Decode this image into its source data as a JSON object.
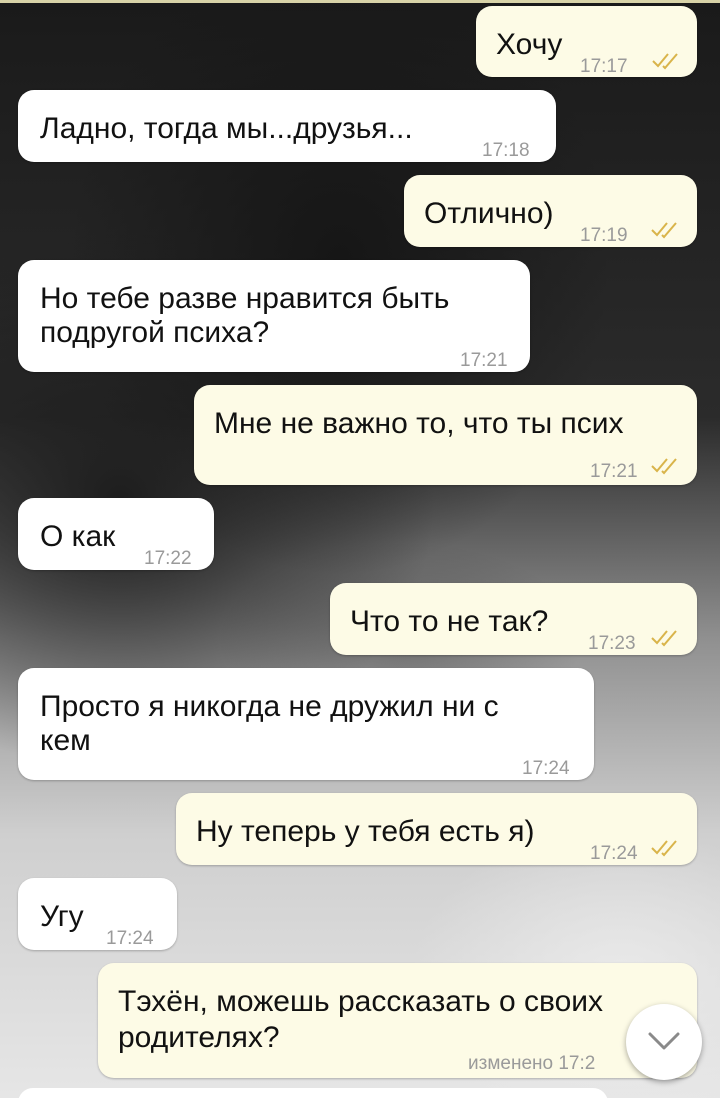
{
  "chat": {
    "messages": [
      {
        "id": "m1",
        "side": "out",
        "text": "Хочу",
        "time": "17:17",
        "read": true
      },
      {
        "id": "m2",
        "side": "in",
        "text": "Ладно, тогда мы...друзья...",
        "time": "17:18"
      },
      {
        "id": "m3",
        "side": "out",
        "text": "Отлично)",
        "time": "17:19",
        "read": true
      },
      {
        "id": "m4",
        "side": "in",
        "text_lines": [
          "Но тебе разве нравится быть",
          "подругой психа?"
        ],
        "time": "17:21"
      },
      {
        "id": "m5",
        "side": "out",
        "text": "Мне не важно то, что ты псих",
        "time": "17:21",
        "read": true
      },
      {
        "id": "m6",
        "side": "in",
        "text": "О как",
        "time": "17:22"
      },
      {
        "id": "m7",
        "side": "out",
        "text": "Что то не так?",
        "time": "17:23",
        "read": true
      },
      {
        "id": "m8",
        "side": "in",
        "text_lines": [
          "Просто я никогда не дружил ни с",
          "кем"
        ],
        "time": "17:24"
      },
      {
        "id": "m9",
        "side": "out",
        "text": "Ну теперь у тебя есть я)",
        "time": "17:24",
        "read": true
      },
      {
        "id": "m10",
        "side": "in",
        "text": "Угу",
        "time": "17:24"
      },
      {
        "id": "m11",
        "side": "out",
        "text_lines": [
          "Тэхён, можешь рассказать о своих",
          "родителях?"
        ],
        "time": "изменено 17:2"
      }
    ]
  },
  "icons": {
    "read_receipt": "double-check-icon",
    "scroll_down": "chevron-down-icon"
  },
  "colors": {
    "incoming_bubble": "#ffffff",
    "outgoing_bubble": "#fdfbe6",
    "timestamp": "#9a9a9a",
    "read_check": "#d9b44a"
  }
}
